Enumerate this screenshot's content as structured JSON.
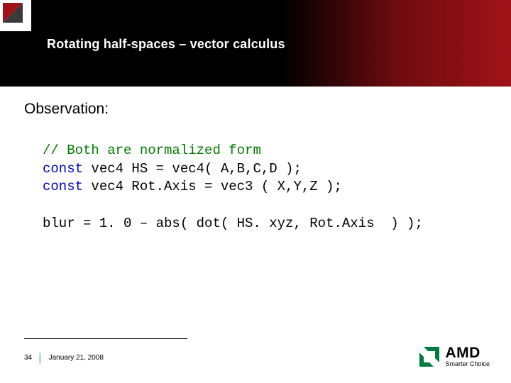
{
  "title": "Rotating half-spaces – vector calculus",
  "observation_label": "Observation:",
  "code": {
    "comment": "// Both are normalized form",
    "line1_kw": "const",
    "line1_rest": " vec4 HS = vec4( A,B,C,D );",
    "line2_kw": "const",
    "line2_rest": " vec4 Rot.Axis = vec3 ( X,Y,Z );",
    "line3": "blur = 1. 0 – abs( dot( HS. xyz, Rot.Axis  ) );"
  },
  "footer": {
    "page": "34",
    "date": "January 21, 2008"
  },
  "amd": {
    "name": "AMD",
    "tagline": "Smarter Choice"
  }
}
